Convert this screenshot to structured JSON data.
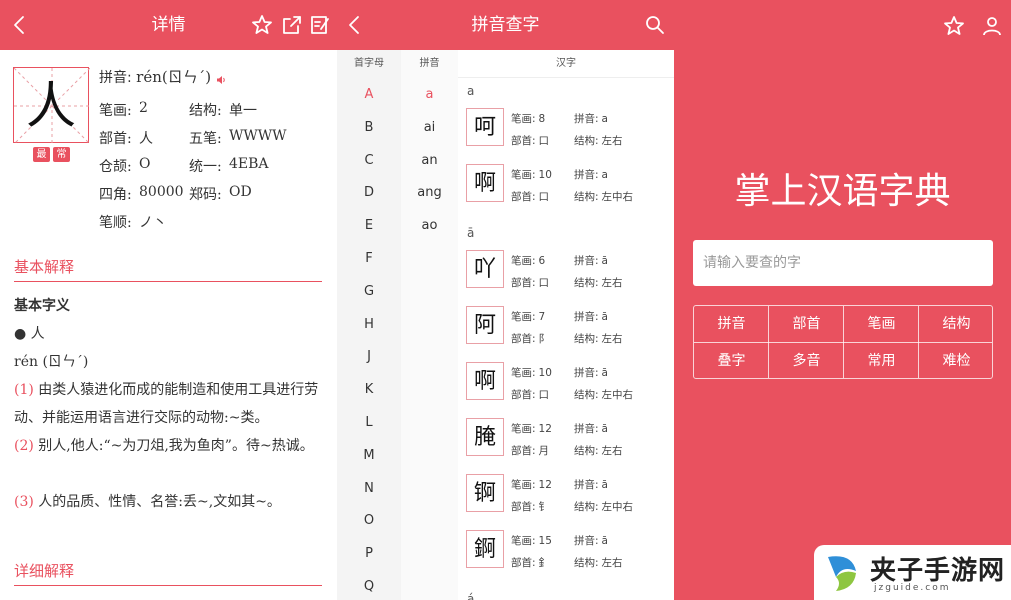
{
  "detail": {
    "title": "详情",
    "char": "人",
    "badges": [
      "最",
      "常"
    ],
    "pinyin_label": "拼音:",
    "pinyin_value": "rén(ㄖㄣˊ)",
    "rows": [
      {
        "k1": "笔画:",
        "v1": "2",
        "k2": "结构:",
        "v2": "单一"
      },
      {
        "k1": "部首:",
        "v1": "人",
        "k2": "五笔:",
        "v2": "WWWW"
      },
      {
        "k1": "仓颉:",
        "v1": "O",
        "k2": "统一:",
        "v2": "4EBA"
      },
      {
        "k1": "四角:",
        "v1": "80000",
        "k2": "郑码:",
        "v2": "OD"
      },
      {
        "k1": "笔顺:",
        "v1": "ノ丶",
        "k2": "",
        "v2": ""
      }
    ],
    "basic_title": "基本解释",
    "basic_sub": "基本字义",
    "basic_char": "● 人",
    "basic_pinyin": "rén (ㄖㄣˊ)",
    "defs": [
      {
        "num": "(1)",
        "text": "由类人猿进化而成的能制造和使用工具进行劳动、并能运用语言进行交际的动物:~类。"
      },
      {
        "num": "(2)",
        "text": "别人,他人:“~为刀俎,我为鱼肉”。待~热诚。"
      },
      {
        "num": "(3)",
        "text": "人的品质、性情、名誉:丢~,文如其~。"
      }
    ],
    "detail_title": "详细解释"
  },
  "pinyin_lookup": {
    "title": "拼音查字",
    "headers": {
      "letter": "首字母",
      "pinyin": "拼音",
      "hanzi": "汉字"
    },
    "letters": [
      "A",
      "B",
      "C",
      "D",
      "E",
      "F",
      "G",
      "H",
      "J",
      "K",
      "L",
      "M",
      "N",
      "O",
      "P",
      "Q"
    ],
    "active_letter": "A",
    "syllables": [
      "a",
      "ai",
      "an",
      "ang",
      "ao"
    ],
    "active_syllable": "a",
    "groups": [
      {
        "label": "a",
        "items": [
          {
            "ch": "呵",
            "strokes": "8",
            "py": "a",
            "radical": "口",
            "struct": "左右"
          },
          {
            "ch": "啊",
            "strokes": "10",
            "py": "a",
            "radical": "口",
            "struct": "左中右"
          }
        ]
      },
      {
        "label": "ā",
        "items": [
          {
            "ch": "吖",
            "strokes": "6",
            "py": "ā",
            "radical": "口",
            "struct": "左右"
          },
          {
            "ch": "阿",
            "strokes": "7",
            "py": "ā",
            "radical": "阝",
            "struct": "左右"
          },
          {
            "ch": "啊",
            "strokes": "10",
            "py": "ā",
            "radical": "口",
            "struct": "左中右"
          },
          {
            "ch": "腌",
            "strokes": "12",
            "py": "ā",
            "radical": "月",
            "struct": "左右"
          },
          {
            "ch": "锕",
            "strokes": "12",
            "py": "ā",
            "radical": "钅",
            "struct": "左中右"
          },
          {
            "ch": "錒",
            "strokes": "15",
            "py": "ā",
            "radical": "釒",
            "struct": "左右"
          }
        ]
      },
      {
        "label": "á",
        "items": []
      }
    ],
    "labels": {
      "strokes": "笔画:",
      "py": "拼音:",
      "radical": "部首:",
      "struct": "结构:"
    }
  },
  "home": {
    "title": "掌上汉语字典",
    "search_placeholder": "请输入要查的字",
    "menu": [
      "拼音",
      "部首",
      "笔画",
      "结构",
      "叠字",
      "多音",
      "常用",
      "难检"
    ]
  },
  "watermark": {
    "text": "夹子手游网",
    "sub": "jzguide.com"
  },
  "colors": {
    "accent": "#e9515f"
  }
}
